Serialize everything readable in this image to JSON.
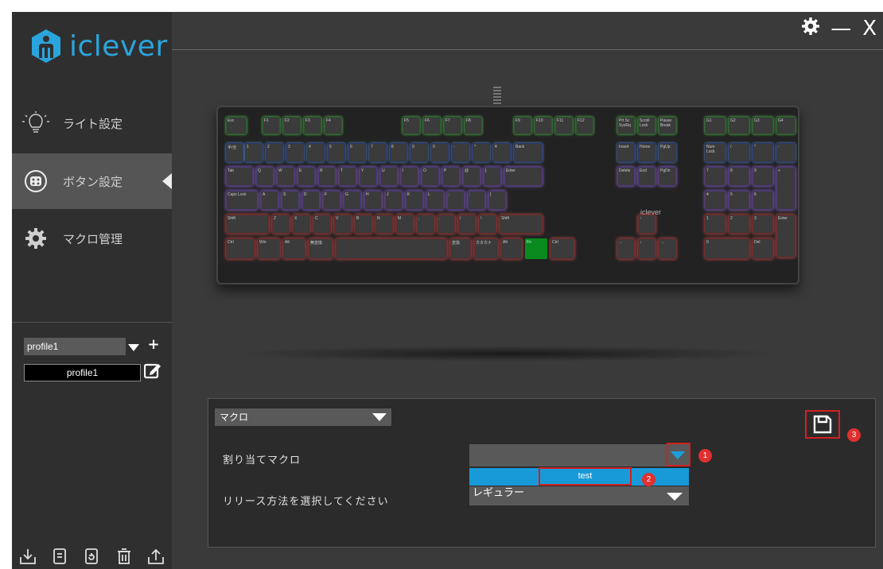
{
  "brand": {
    "logo_text": "iclever",
    "color": "#2aa4dc"
  },
  "window_controls": {
    "settings": "⚙",
    "minimize": "—",
    "close": "X"
  },
  "sidebar": {
    "items": [
      {
        "label": "ライト設定",
        "icon": "bulb-icon",
        "active": false
      },
      {
        "label": "ボタン設定",
        "icon": "keycap-icon",
        "active": true
      },
      {
        "label": "マクロ管理",
        "icon": "gear-icon",
        "active": false
      }
    ],
    "profile_select_value": "profile1",
    "profile_add_label": "+",
    "profile_name_value": "profile1",
    "bottom_icons": [
      "import-icon",
      "document-icon",
      "refresh-doc-icon",
      "trash-icon",
      "export-icon"
    ]
  },
  "keyboard": {
    "logo_text": "iclever",
    "rows": [
      [
        "Esc",
        "F1",
        "F2",
        "F3",
        "F4",
        "F5",
        "F6",
        "F7",
        "F8",
        "F9",
        "F10",
        "F11",
        "F12",
        "Prt Sc SysRq",
        "Scroll Lock",
        "Pause Break",
        "G1",
        "G2",
        "G3",
        "G4"
      ],
      [
        "半/全",
        "1",
        "2",
        "3",
        "4",
        "5",
        "6",
        "7",
        "8",
        "9",
        "0",
        "-",
        "^",
        "¥",
        "Back",
        "Insert",
        "Home",
        "PgUp",
        "Num Lock",
        "/",
        "*",
        "-"
      ],
      [
        "Tab",
        "Q",
        "W",
        "E",
        "R",
        "T",
        "Y",
        "U",
        "I",
        "O",
        "P",
        "@",
        "[",
        "Enter",
        "Delete",
        "End",
        "PgDn",
        "7",
        "8",
        "9",
        "+"
      ],
      [
        "Caps Lock",
        "A",
        "S",
        "D",
        "F",
        "G",
        "H",
        "J",
        "K",
        "L",
        ";",
        ":",
        "]",
        "4",
        "5",
        "6"
      ],
      [
        "Shift",
        "Z",
        "X",
        "C",
        "V",
        "B",
        "N",
        "M",
        ",",
        ".",
        "/",
        "\\",
        "Shift",
        "↑",
        "1",
        "2",
        "3",
        "Enter"
      ],
      [
        "Ctrl",
        "Win",
        "Alt",
        "無変換",
        "",
        "変換",
        "カタカナ",
        "Alt",
        "Fn",
        "Ctrl",
        "←",
        "↓",
        "→",
        "0",
        "Del"
      ]
    ]
  },
  "panel": {
    "type_select_value": "マクロ",
    "assign_macro_label": "割り当てマクロ",
    "macro_select_value": "",
    "dropdown_options": [
      "test"
    ],
    "release_label": "リリース方法を選択してください",
    "release_select_value": "レギュラー",
    "badges": [
      "1",
      "2",
      "3"
    ],
    "save_icon": "save-icon"
  }
}
